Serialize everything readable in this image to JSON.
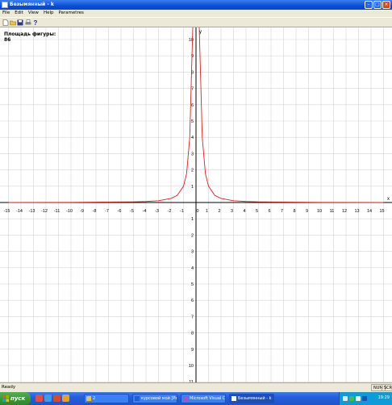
{
  "window": {
    "title": "Безымянный - k"
  },
  "menu": [
    "File",
    "Edit",
    "View",
    "Help",
    "Parametres"
  ],
  "toolbar": {
    "icons": [
      "new-file-icon",
      "open-folder-icon",
      "save-disk-icon",
      "print-icon",
      "help-icon"
    ]
  },
  "graph": {
    "area_label": "Площадь фигуры:",
    "area_value": "86",
    "x_axis_label": "x",
    "y_axis_label": "y",
    "x_ticks": [
      "-15",
      "-14",
      "-13",
      "-12",
      "-11",
      "-10",
      "-9",
      "-8",
      "-7",
      "-6",
      "-5",
      "-4",
      "-3",
      "-2",
      "-1",
      "0",
      "1",
      "2",
      "3",
      "4",
      "5",
      "6",
      "7",
      "8",
      "9",
      "10",
      "11",
      "12",
      "13",
      "14",
      "15"
    ],
    "y_ticks_up": [
      "1",
      "2",
      "3",
      "4",
      "5",
      "6",
      "7",
      "8",
      "9",
      "10",
      "11"
    ],
    "y_ticks_down": [
      "1",
      "2",
      "3",
      "4",
      "5",
      "6",
      "7",
      "8",
      "9",
      "10",
      "11"
    ],
    "curve_color": "#e02020",
    "grid_color": "#d4d4d4"
  },
  "chart_data": {
    "type": "line",
    "xlabel": "x",
    "ylabel": "y",
    "xlim": [
      -15,
      15
    ],
    "ylim": [
      -11,
      11
    ],
    "grid": true,
    "series": [
      {
        "x": [
          -15,
          -10,
          -5,
          -4,
          -3,
          -2,
          -1.5,
          -1,
          -0.75,
          -0.5,
          -0.35,
          -0.25,
          -0.2,
          -0.15,
          0.15,
          0.2,
          0.25,
          0.35,
          0.5,
          0.75,
          1,
          1.5,
          2,
          3,
          4,
          5,
          10,
          15
        ],
        "y": [
          0.004,
          0.01,
          0.04,
          0.0625,
          0.11,
          0.25,
          0.44,
          1,
          1.78,
          4,
          8.2,
          16,
          25,
          44,
          44,
          25,
          16,
          8.2,
          4,
          1.78,
          1,
          0.44,
          0.25,
          0.11,
          0.0625,
          0.04,
          0.01,
          0.004
        ]
      }
    ]
  },
  "status": {
    "text": "Ready",
    "num": "NUM",
    "scrl": "SCRL"
  },
  "taskbar": {
    "start_label": "пуск",
    "tasks": [
      "2",
      "курсовой мой [Режи...",
      "Microsoft Visual C++",
      "Безымянный - k"
    ],
    "clock": "19:29"
  }
}
